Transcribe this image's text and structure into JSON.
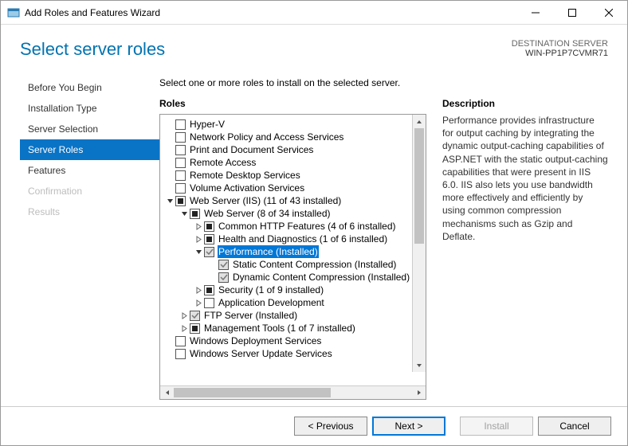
{
  "window": {
    "title": "Add Roles and Features Wizard"
  },
  "header": {
    "title": "Select server roles",
    "dest_label": "DESTINATION SERVER",
    "dest_server": "WIN-PP1P7CVMR71"
  },
  "sidebar": {
    "steps": [
      {
        "label": "Before You Begin",
        "state": "normal"
      },
      {
        "label": "Installation Type",
        "state": "normal"
      },
      {
        "label": "Server Selection",
        "state": "normal"
      },
      {
        "label": "Server Roles",
        "state": "active"
      },
      {
        "label": "Features",
        "state": "normal"
      },
      {
        "label": "Confirmation",
        "state": "disabled"
      },
      {
        "label": "Results",
        "state": "disabled"
      }
    ]
  },
  "main": {
    "intro": "Select one or more roles to install on the selected server.",
    "roles_label": "Roles",
    "desc_label": "Description",
    "desc_text": "Performance provides infrastructure for output caching by integrating the dynamic output-caching capabilities of ASP.NET with the static output-caching capabilities that were present in IIS 6.0. IIS also lets you use bandwidth more effectively and efficiently by using common compression mechanisms such as Gzip and Deflate."
  },
  "tree": [
    {
      "indent": 0,
      "expander": "none",
      "check": "empty",
      "label": "Hyper-V"
    },
    {
      "indent": 0,
      "expander": "none",
      "check": "empty",
      "label": "Network Policy and Access Services"
    },
    {
      "indent": 0,
      "expander": "none",
      "check": "empty",
      "label": "Print and Document Services"
    },
    {
      "indent": 0,
      "expander": "none",
      "check": "empty",
      "label": "Remote Access"
    },
    {
      "indent": 0,
      "expander": "none",
      "check": "empty",
      "label": "Remote Desktop Services"
    },
    {
      "indent": 0,
      "expander": "none",
      "check": "empty",
      "label": "Volume Activation Services"
    },
    {
      "indent": 0,
      "expander": "expanded",
      "check": "filled",
      "label": "Web Server (IIS) (11 of 43 installed)"
    },
    {
      "indent": 1,
      "expander": "expanded",
      "check": "filled",
      "label": "Web Server (8 of 34 installed)"
    },
    {
      "indent": 2,
      "expander": "collapsed",
      "check": "filled",
      "label": "Common HTTP Features (4 of 6 installed)"
    },
    {
      "indent": 2,
      "expander": "collapsed",
      "check": "filled",
      "label": "Health and Diagnostics (1 of 6 installed)"
    },
    {
      "indent": 2,
      "expander": "expanded",
      "check": "checked-gray",
      "label": "Performance (Installed)",
      "selected": true
    },
    {
      "indent": 3,
      "expander": "none",
      "check": "checked-gray",
      "label": "Static Content Compression (Installed)"
    },
    {
      "indent": 3,
      "expander": "none",
      "check": "checked-gray",
      "label": "Dynamic Content Compression (Installed)"
    },
    {
      "indent": 2,
      "expander": "collapsed",
      "check": "filled",
      "label": "Security (1 of 9 installed)"
    },
    {
      "indent": 2,
      "expander": "collapsed",
      "check": "empty",
      "label": "Application Development"
    },
    {
      "indent": 1,
      "expander": "collapsed",
      "check": "checked-gray",
      "label": "FTP Server (Installed)"
    },
    {
      "indent": 1,
      "expander": "collapsed",
      "check": "filled",
      "label": "Management Tools (1 of 7 installed)"
    },
    {
      "indent": 0,
      "expander": "none",
      "check": "empty",
      "label": "Windows Deployment Services"
    },
    {
      "indent": 0,
      "expander": "none",
      "check": "empty",
      "label": "Windows Server Update Services"
    }
  ],
  "footer": {
    "previous": "< Previous",
    "next": "Next >",
    "install": "Install",
    "cancel": "Cancel"
  }
}
